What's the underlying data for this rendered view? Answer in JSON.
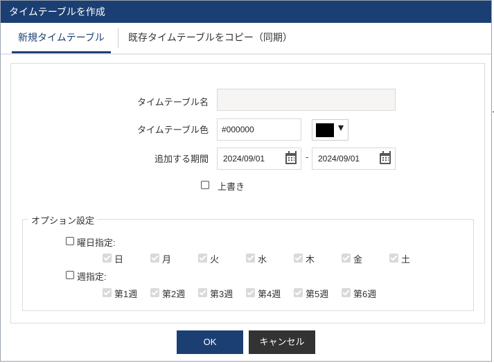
{
  "dialog": {
    "title": "タイムテーブルを作成"
  },
  "tabs": [
    {
      "label": "新規タイムテーブル",
      "active": true
    },
    {
      "label": "既存タイムテーブルをコピー（同期）",
      "active": false
    }
  ],
  "form": {
    "name_label": "タイムテーブル名",
    "name_value": "",
    "color_label": "タイムテーブル色",
    "color_value": "#000000",
    "color_swatch": "#000000",
    "period_label": "追加する期間",
    "period_start": "2024/09/01",
    "period_separator": "-",
    "period_end": "2024/09/01",
    "overwrite_label": "上書き",
    "overwrite_checked": false
  },
  "options": {
    "legend": "オプション設定",
    "weekday_label": "曜日指定:",
    "weekday_checked": false,
    "weekdays": [
      "日",
      "月",
      "火",
      "水",
      "木",
      "金",
      "土"
    ],
    "week_label": "週指定:",
    "week_checked": false,
    "weeks": [
      "第1週",
      "第2週",
      "第3週",
      "第4週",
      "第5週",
      "第6週"
    ]
  },
  "buttons": {
    "ok": "OK",
    "cancel": "キャンセル"
  },
  "colors": {
    "title_bg": "#1b3f73",
    "accent": "#1b3f73",
    "cancel_bg": "#333333"
  }
}
